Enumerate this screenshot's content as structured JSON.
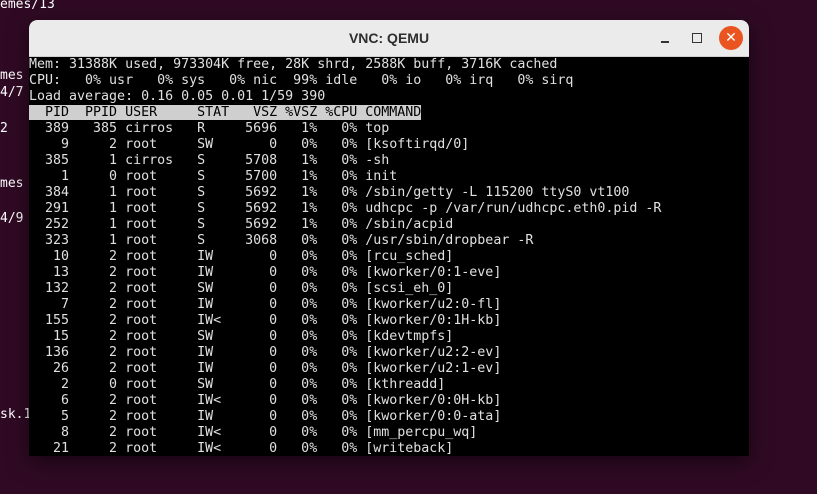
{
  "background_terminal": {
    "lines": [
      "emes/13",
      "mes",
      "4/7",
      "2",
      "mes",
      "4/9",
      "sk.1"
    ]
  },
  "window": {
    "title": "VNC: QEMU",
    "buttons": {
      "minimize": "minimize-icon",
      "maximize": "maximize-icon",
      "close": "close-icon"
    }
  },
  "top": {
    "mem_line": "Mem: 31388K used, 973304K free, 28K shrd, 2588K buff, 3716K cached",
    "cpu_line": "CPU:   0% usr   0% sys   0% nic  99% idle   0% io   0% irq   0% sirq",
    "load_line": "Load average: 0.16 0.05 0.01 1/59 390",
    "header": "  PID  PPID USER     STAT   VSZ %VSZ %CPU COMMAND",
    "rows": [
      "  389   385 cirros   R     5696   1%   0% top",
      "    9     2 root     SW       0   0%   0% [ksoftirqd/0]",
      "  385     1 cirros   S     5708   1%   0% -sh",
      "    1     0 root     S     5700   1%   0% init",
      "  384     1 root     S     5692   1%   0% /sbin/getty -L 115200 ttyS0 vt100",
      "  291     1 root     S     5692   1%   0% udhcpc -p /var/run/udhcpc.eth0.pid -R",
      "  252     1 root     S     5692   1%   0% /sbin/acpid",
      "  323     1 root     S     3068   0%   0% /usr/sbin/dropbear -R",
      "   10     2 root     IW       0   0%   0% [rcu_sched]",
      "   13     2 root     IW       0   0%   0% [kworker/0:1-eve]",
      "  132     2 root     SW       0   0%   0% [scsi_eh_0]",
      "    7     2 root     IW       0   0%   0% [kworker/u2:0-fl]",
      "  155     2 root     IW<      0   0%   0% [kworker/0:1H-kb]",
      "   15     2 root     SW       0   0%   0% [kdevtmpfs]",
      "  136     2 root     IW       0   0%   0% [kworker/u2:2-ev]",
      "   26     2 root     IW       0   0%   0% [kworker/u2:1-ev]",
      "    2     0 root     SW       0   0%   0% [kthreadd]",
      "    6     2 root     IW<      0   0%   0% [kworker/0:0H-kb]",
      "    5     2 root     IW       0   0%   0% [kworker/0:0-ata]",
      "    8     2 root     IW<      0   0%   0% [mm_percpu_wq]",
      "   21     2 root     IW<      0   0%   0% [writeback]"
    ]
  }
}
